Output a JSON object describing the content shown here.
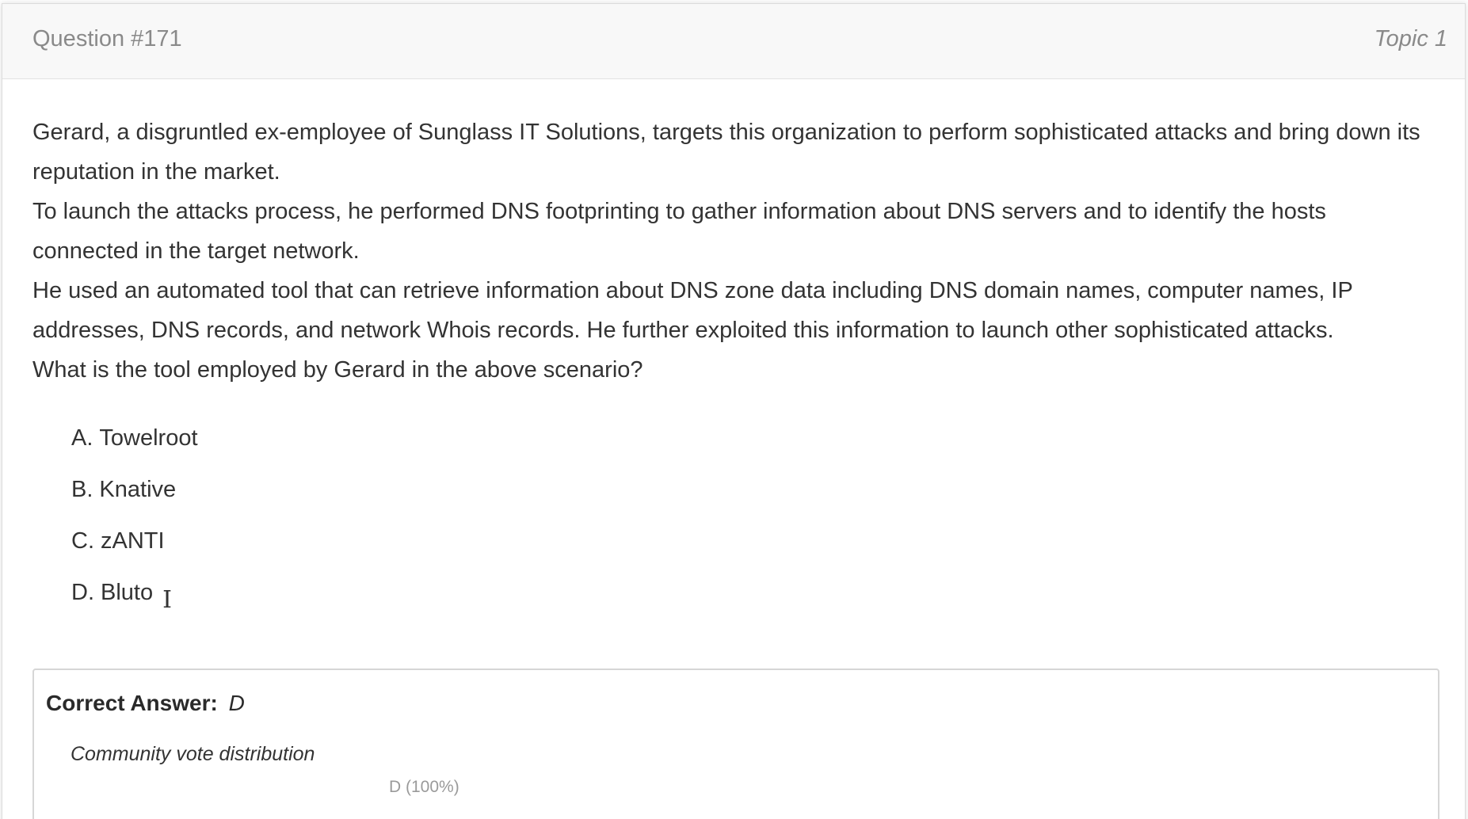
{
  "header": {
    "question_number": "Question #171",
    "topic": "Topic 1"
  },
  "question": {
    "paragraphs": [
      "Gerard, a disgruntled ex-employee of Sunglass IT Solutions, targets this organization to perform sophisticated attacks and bring down its reputation in the market.",
      "To launch the attacks process, he performed DNS footprinting to gather information about DNS servers and to identify the hosts connected in the target network.",
      "He used an automated tool that can retrieve information about DNS zone data including DNS domain names, computer names, IP addresses, DNS records, and network Whois records. He further exploited this information to launch other sophisticated attacks.",
      "What is the tool employed by Gerard in the above scenario?"
    ]
  },
  "choices": [
    {
      "letter": "A.",
      "text": "Towelroot"
    },
    {
      "letter": "B.",
      "text": "Knative"
    },
    {
      "letter": "C.",
      "text": "zANTI"
    },
    {
      "letter": "D.",
      "text": "Bluto"
    }
  ],
  "answer": {
    "label": "Correct Answer:",
    "value": "D"
  },
  "community": {
    "title": "Community vote distribution",
    "bar_label": "D (100%)",
    "distribution": [
      {
        "option": "D",
        "percent": 100
      }
    ]
  },
  "icons": {
    "cursor": "text-cursor-icon"
  }
}
